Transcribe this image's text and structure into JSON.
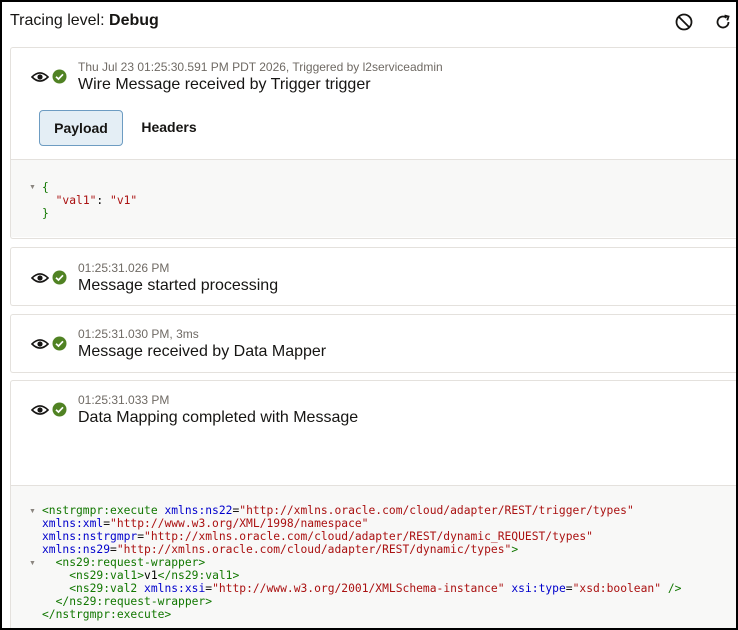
{
  "header": {
    "tracing_label": "Tracing level:",
    "tracing_value": "Debug"
  },
  "icons": {
    "clear": "ban-icon",
    "refresh": "refresh-icon",
    "view": "eye-icon",
    "status": "check-circle-icon"
  },
  "colors": {
    "success": "#508223",
    "tab_active_bg": "#e4eef5",
    "tab_active_border": "#6d9cc2",
    "xml_tag": "#117700",
    "xml_attr": "#0000cc",
    "xml_string": "#aa1111"
  },
  "activities": [
    {
      "meta": "Thu Jul 23 01:25:30.591 PM PDT 2026, Triggered by l2serviceadmin",
      "title": "Wire Message received by Trigger trigger"
    },
    {
      "meta": "01:25:31.026 PM",
      "title": "Message started processing"
    },
    {
      "meta": "01:25:31.030 PM, 3ms",
      "title": "Message received by Data Mapper"
    },
    {
      "meta": "01:25:31.033 PM",
      "title": "Data Mapping completed with Message"
    }
  ],
  "tabs": {
    "payload": "Payload",
    "headers": "Headers"
  },
  "json_payload": {
    "open": "{",
    "key": "\"val1\"",
    "colon": ": ",
    "value": "\"v1\"",
    "close": "}"
  },
  "xml_payload": {
    "l1_tag": "<nstrgmpr:execute",
    "l1_attr": "xmlns:ns22",
    "l1_val": "\"http://xmlns.oracle.com/cloud/adapter/REST/trigger/types\"",
    "l2_attr": "xmlns:xml",
    "l2_val": "\"http://www.w3.org/XML/1998/namespace\"",
    "l3_attr": "xmlns:nstrgmpr",
    "l3_val": "\"http://xmlns.oracle.com/cloud/adapter/REST/dynamic_REQUEST/types\"",
    "l4_attr": "xmlns:ns29",
    "l4_val": "\"http://xmlns.oracle.com/cloud/adapter/REST/dynamic/types\"",
    "l4_end": ">",
    "l5_tag": "<ns29:request-wrapper>",
    "l6_open": "<ns29:val1>",
    "l6_text": "v1",
    "l6_close": "</ns29:val1>",
    "l7_tag": "<ns29:val2",
    "l7_attr1": "xmlns:xsi",
    "l7_val1": "\"http://www.w3.org/2001/XMLSchema-instance\"",
    "l7_attr2": "xsi:type",
    "l7_val2": "\"xsd:boolean\"",
    "l7_end": " />",
    "l8_tag": "</ns29:request-wrapper>",
    "l9_tag": "</nstrgmpr:execute>"
  }
}
